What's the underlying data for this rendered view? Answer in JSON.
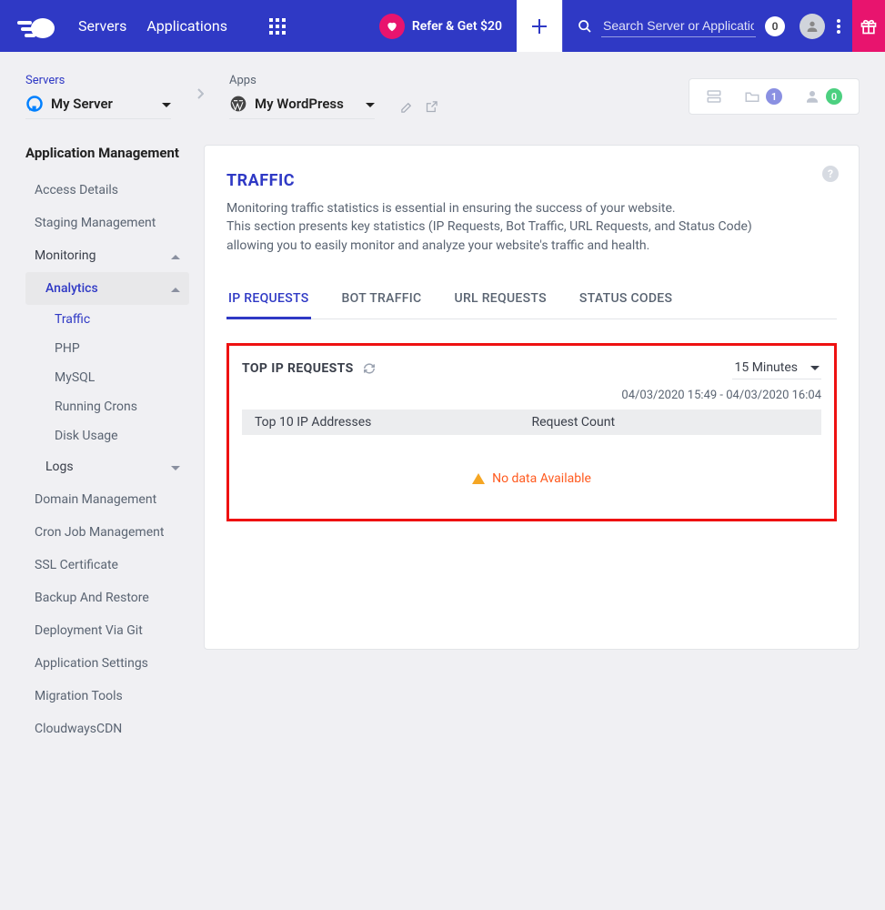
{
  "topbar": {
    "nav": {
      "servers": "Servers",
      "applications": "Applications"
    },
    "refer_label": "Refer & Get $20",
    "search_placeholder": "Search Server or Application",
    "search_count": "0"
  },
  "breadcrumb": {
    "servers_label": "Servers",
    "server_name": "My Server",
    "apps_label": "Apps",
    "app_name": "My WordPress",
    "stats": {
      "projects": "1",
      "team": "0"
    }
  },
  "sidebar": {
    "heading": "Application Management",
    "items": {
      "access": "Access Details",
      "staging": "Staging Management",
      "monitoring": "Monitoring",
      "analytics": "Analytics",
      "analytics_children": {
        "traffic": "Traffic",
        "php": "PHP",
        "mysql": "MySQL",
        "crons": "Running Crons",
        "disk": "Disk Usage"
      },
      "logs": "Logs",
      "domain": "Domain Management",
      "cron": "Cron Job Management",
      "ssl": "SSL Certificate",
      "backup": "Backup And Restore",
      "git": "Deployment Via Git",
      "settings": "Application Settings",
      "migration": "Migration Tools",
      "cdn": "CloudwaysCDN"
    }
  },
  "main": {
    "title": "TRAFFIC",
    "description_l1": "Monitoring traffic statistics is essential in ensuring the success of your website.",
    "description_l2": "This section presents key statistics (IP Requests, Bot Traffic, URL Requests, and Status Code)",
    "description_l3": "allowing you to easily monitor and analyze your website's traffic and health.",
    "tabs": {
      "ip": "IP REQUESTS",
      "bot": "BOT TRAFFIC",
      "url": "URL REQUESTS",
      "status": "STATUS CODES"
    },
    "panel": {
      "title": "TOP IP REQUESTS",
      "range": "15 Minutes",
      "daterange": "04/03/2020 15:49 - 04/03/2020 16:04",
      "col1": "Top 10 IP Addresses",
      "col2": "Request Count",
      "nodata": "No data Available"
    }
  }
}
